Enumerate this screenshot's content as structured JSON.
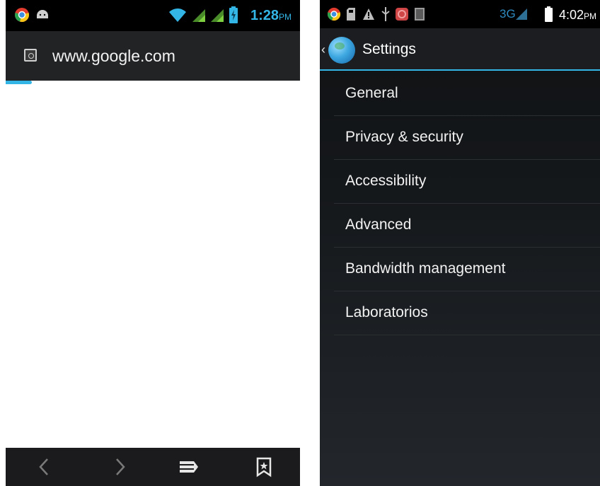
{
  "left_screen": {
    "status_bar": {
      "time": "1:28",
      "ampm": "PM",
      "left_icons": [
        "chrome-icon",
        "android-icon"
      ],
      "right_icons": [
        "wifi-icon",
        "signal-icon",
        "signal-icon",
        "battery-icon"
      ]
    },
    "url_bar": {
      "url": "www.google.com",
      "favicon": "page-icon"
    },
    "page_load_progress": 0.09,
    "bottom_toolbar": {
      "buttons": [
        "back-icon",
        "forward-icon",
        "tabs-icon",
        "bookmark-icon"
      ]
    }
  },
  "right_screen": {
    "status_bar": {
      "time": "4:02",
      "ampm": "PM",
      "network": "3G",
      "left_icons": [
        "chrome-icon",
        "sd-card-icon",
        "warning-icon",
        "usb-icon",
        "app-icon",
        "notification-icon"
      ],
      "right_icons": [
        "signal-icon",
        "battery-icon"
      ]
    },
    "action_bar": {
      "title": "Settings",
      "icon": "globe-icon"
    },
    "menu": [
      {
        "label": "General"
      },
      {
        "label": "Privacy & security"
      },
      {
        "label": "Accessibility"
      },
      {
        "label": "Advanced"
      },
      {
        "label": "Bandwidth management"
      },
      {
        "label": "Laboratorios"
      }
    ]
  },
  "colors": {
    "accent": "#33b5e5",
    "status_bar": "#000000",
    "toolbar": "#222325",
    "settings_bg": "#15181b"
  }
}
